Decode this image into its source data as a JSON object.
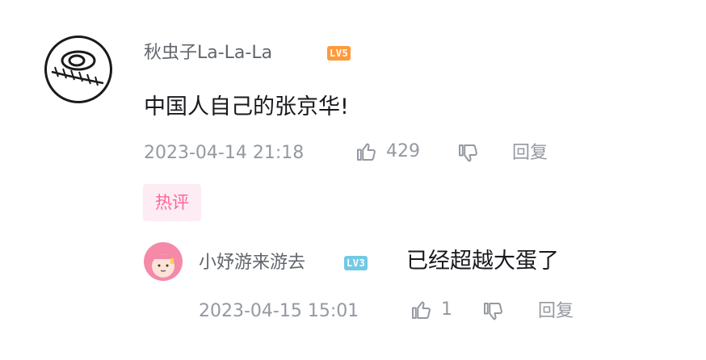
{
  "comment": {
    "username": "秋虫子La-La-La",
    "level": "LV5",
    "level_color": "#ff9a3c",
    "text": "中国人自己的张京华!",
    "timestamp": "2023-04-14 21:18",
    "like_count": "429",
    "reply_label": "回复",
    "hot_tag": "热评"
  },
  "reply": {
    "username": "小妤游来游去",
    "level": "LV3",
    "level_color": "#73c9e5",
    "text": "已经超越大蛋了",
    "timestamp": "2023-04-15 15:01",
    "like_count": "1",
    "reply_label": "回复"
  },
  "icons": {
    "like": "thumbs-up-icon",
    "dislike": "thumbs-down-icon"
  },
  "colors": {
    "username": "#61666d",
    "text": "#18191c",
    "meta": "#9499a0",
    "hot_tag_bg": "#fdecf3",
    "hot_tag_text": "#ff6699"
  }
}
